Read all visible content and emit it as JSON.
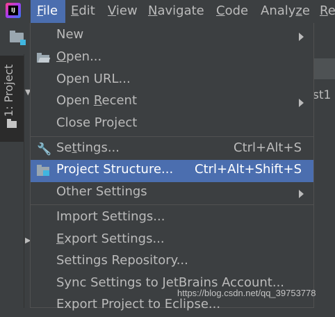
{
  "menubar": {
    "items": [
      {
        "pre": "",
        "mn": "F",
        "post": "ile"
      },
      {
        "pre": "",
        "mn": "E",
        "post": "dit"
      },
      {
        "pre": "",
        "mn": "V",
        "post": "iew"
      },
      {
        "pre": "",
        "mn": "N",
        "post": "avigate"
      },
      {
        "pre": "",
        "mn": "C",
        "post": "ode"
      },
      {
        "pre": "Analy",
        "mn": "z",
        "post": "e"
      },
      {
        "pre": "",
        "mn": "R",
        "post": "e"
      }
    ]
  },
  "logo": {
    "text": "IJ"
  },
  "tool_window": {
    "project_label": "1: Project"
  },
  "editor": {
    "tab_fragment": "st1"
  },
  "file_menu": {
    "new": {
      "label": "New"
    },
    "open": {
      "pre": "",
      "mn": "O",
      "post": "pen..."
    },
    "open_url": {
      "label": "Open URL..."
    },
    "open_recent": {
      "pre": "Open ",
      "mn": "R",
      "post": "ecent"
    },
    "close_project": {
      "label": "Close Project"
    },
    "settings": {
      "pre": "Se",
      "mn": "t",
      "post": "tings...",
      "shortcut": "Ctrl+Alt+S"
    },
    "project_structure": {
      "label": "Project Structure...",
      "shortcut": "Ctrl+Alt+Shift+S"
    },
    "other_settings": {
      "label": "Other Settings"
    },
    "import_settings": {
      "label": "Import Settings..."
    },
    "export_settings": {
      "pre": "",
      "mn": "E",
      "post": "xport Settings..."
    },
    "settings_repository": {
      "label": "Settings Repository..."
    },
    "sync_settings": {
      "label": "Sync Settings to JetBrains Account..."
    },
    "export_eclipse": {
      "label": "Export Project to Eclipse..."
    }
  },
  "watermark": {
    "text": "https://blog.csdn.net/qq_39753778"
  },
  "colors": {
    "background": "#3c3f41",
    "selection": "#4b6eaf",
    "text": "#bbbbbb"
  }
}
